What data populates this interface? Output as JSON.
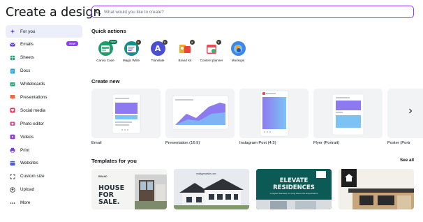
{
  "page": {
    "title": "Create a design"
  },
  "search": {
    "placeholder": "What would you like to create?"
  },
  "sidebar": {
    "items": [
      {
        "label": "For you",
        "icon": "sparkle-icon",
        "color": "#5a35d8",
        "active": true
      },
      {
        "label": "Emails",
        "icon": "email-icon",
        "color": "#5a35d8",
        "badge": "New"
      },
      {
        "label": "Sheets",
        "icon": "sheets-icon",
        "color": "#1ea67a"
      },
      {
        "label": "Docs",
        "icon": "docs-icon",
        "color": "#1a9fd8"
      },
      {
        "label": "Whiteboards",
        "icon": "whiteboard-icon",
        "color": "#1ea67a"
      },
      {
        "label": "Presentations",
        "icon": "presentation-icon",
        "color": "#f0693a"
      },
      {
        "label": "Social media",
        "icon": "heart-icon",
        "color": "#e8345a"
      },
      {
        "label": "Photo editor",
        "icon": "camera-icon",
        "color": "#e0429e"
      },
      {
        "label": "Videos",
        "icon": "video-icon",
        "color": "#8e3fd6"
      },
      {
        "label": "Print",
        "icon": "print-icon",
        "color": "#7b3fe4"
      },
      {
        "label": "Websites",
        "icon": "website-icon",
        "color": "#4a5bdc"
      },
      {
        "label": "Custom size",
        "icon": "custom-size-icon",
        "color": "#0e1318"
      },
      {
        "label": "Upload",
        "icon": "upload-icon",
        "color": "#0e1318"
      },
      {
        "label": "More",
        "icon": "more-icon",
        "color": "#0e1318"
      }
    ]
  },
  "quick_actions": {
    "title": "Quick actions",
    "items": [
      {
        "label": "Canva Code",
        "badge": "New",
        "icon": "canva-code-icon"
      },
      {
        "label": "Magic Write",
        "icon": "magic-write-icon"
      },
      {
        "label": "Translate",
        "icon": "translate-icon"
      },
      {
        "label": "Brand Kit",
        "icon": "brand-kit-icon"
      },
      {
        "label": "Content planner",
        "icon": "calendar-icon"
      },
      {
        "label": "Mockups",
        "icon": "mockups-icon"
      }
    ]
  },
  "create_new": {
    "title": "Create new",
    "items": [
      {
        "label": "Email"
      },
      {
        "label": "Presentation (16:9)"
      },
      {
        "label": "Instagram Post (4:5)"
      },
      {
        "label": "Flyer (Portrait)"
      },
      {
        "label": "Poster (Portr"
      }
    ]
  },
  "templates": {
    "title": "Templates for you",
    "see_all": "See all",
    "items": [
      {
        "brand": "BRAND",
        "line1": "HOUSE",
        "line2": "FOR",
        "line3": "SALE."
      },
      {
        "url": "reallygreatsite.com"
      },
      {
        "line1": "ELEVATE",
        "line2": "RESIDENCES",
        "sub": "A Higher Standard of Living Above the Expectations"
      },
      {}
    ]
  },
  "colors": {
    "accent": "#8b3dff",
    "active_bg": "#eceefa",
    "card_bg": "#f2f3f5"
  }
}
